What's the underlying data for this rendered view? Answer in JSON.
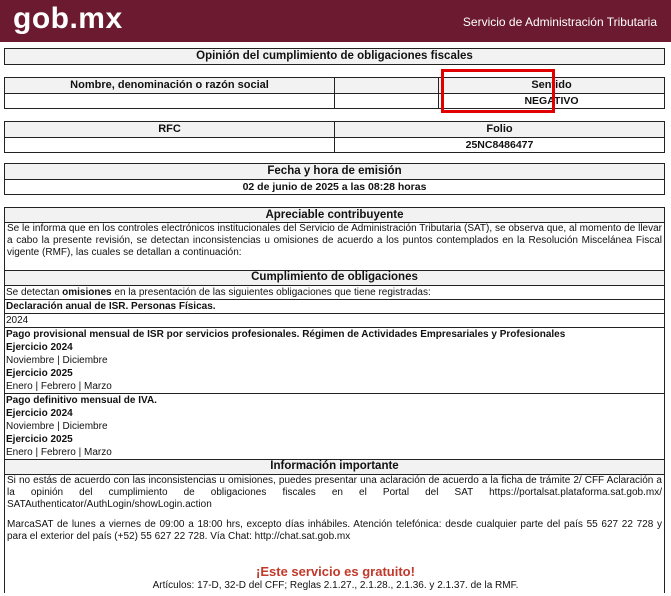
{
  "header": {
    "logo": "gob.mx",
    "agency": "Servicio de Administración Tributaria"
  },
  "title": "Opinión del cumplimiento de obligaciones fiscales",
  "taxpayer": {
    "name_label": "Nombre, denominación o razón social",
    "result_label": "Sentido",
    "result_value": "NEGATIVO"
  },
  "ids": {
    "rfc_label": "RFC",
    "folio_label": "Folio",
    "folio_value": "25NC8486477"
  },
  "issue": {
    "label": "Fecha y hora de emisión",
    "value": "02 de junio de 2025 a las 08:28 horas"
  },
  "notice": {
    "heading": "Apreciable contribuyente",
    "body": "Se le informa que en los controles electrónicos institucionales del Servicio de Administración Tributaria (SAT), se observa que, al momento de llevar a cabo la presente revisión, se detectan inconsistencias u omisiones de acuerdo a los puntos contemplados en la Resolución Miscelánea Fiscal vigente (RMF), las cuales se detallan a continuación:"
  },
  "compliance": {
    "heading": "Cumplimiento de obligaciones",
    "intro_pre": "Se detectan ",
    "intro_bold": "omisiones",
    "intro_post": " en la presentación de las siguientes obligaciones que tiene registradas:",
    "ob1_title": "Declaración anual de ISR. Personas Físicas.",
    "ob1_year": "2024",
    "ob2_title": "Pago provisional mensual de ISR por servicios profesionales. Régimen de Actividades Empresariales y Profesionales",
    "ob2_ex1": "Ejercicio 2024",
    "ob2_ex1_months": "Noviembre | Diciembre",
    "ob2_ex2": "Ejercicio 2025",
    "ob2_ex2_months": "Enero | Febrero | Marzo",
    "ob3_title": "Pago definitivo mensual de IVA.",
    "ob3_ex1": "Ejercicio 2024",
    "ob3_ex1_months": "Noviembre | Diciembre",
    "ob3_ex2": "Ejercicio 2025",
    "ob3_ex2_months": "Enero | Febrero | Marzo"
  },
  "info": {
    "heading": "Información importante",
    "p1": "Si no estás de acuerdo con las inconsistencias u omisiones, puedes presentar una aclaración de acuerdo a la ficha de trámite 2/ CFF Aclaración a la opinión del cumplimiento de obligaciones fiscales en el Portal del SAT https://portalsat.plataforma.sat.gob.mx/ SATAuthenticator/AuthLogin/showLogin.action",
    "p2": "MarcaSAT de lunes a viernes de 09:00 a 18:00 hrs, excepto días inhábiles. Atención telefónica: desde cualquier parte del país 55 627 22 728 y para el exterior del país (+52) 55 627 22 728. Vía Chat: http://chat.sat.gob.mx"
  },
  "footer": {
    "free": "¡Este servicio es gratuito!",
    "articles": "Artículos: 17-D, 32-D del CFF; Reglas 2.1.27., 2.1.28., 2.1.36. y 2.1.37. de la RMF."
  },
  "colors": {
    "brand": "#6b1a2f",
    "highlight": "#e10000",
    "free_text": "#c0392b"
  }
}
